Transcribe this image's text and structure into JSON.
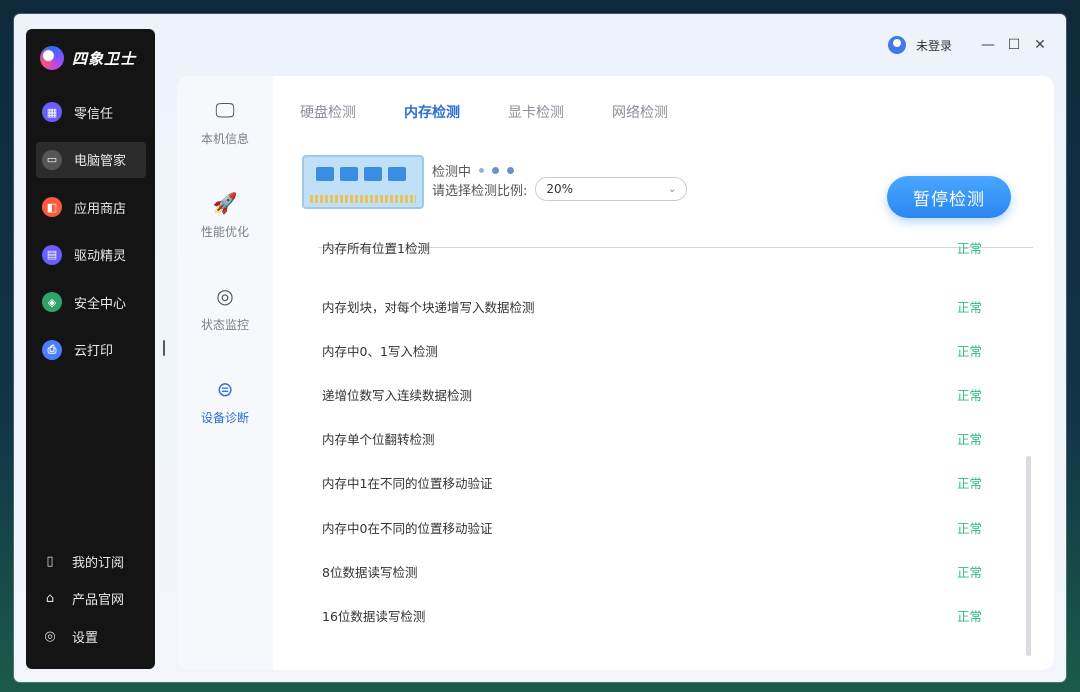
{
  "app": {
    "name": "四象卫士"
  },
  "sidebar": {
    "items": [
      {
        "label": "零信任",
        "icon": "grid-icon",
        "color": "#6b5cff"
      },
      {
        "label": "电脑管家",
        "icon": "monitor-icon",
        "color": "#3f3f3f"
      },
      {
        "label": "应用商店",
        "icon": "store-icon",
        "color": "#ff5a3c"
      },
      {
        "label": "驱动精灵",
        "icon": "driver-icon",
        "color": "#6b5cff"
      },
      {
        "label": "安全中心",
        "icon": "shield-icon",
        "color": "#2fa36b"
      },
      {
        "label": "云打印",
        "icon": "printer-icon",
        "color": "#4a7dff"
      }
    ],
    "bottom": [
      {
        "label": "我的订阅",
        "icon": "book-icon"
      },
      {
        "label": "产品官网",
        "icon": "home-icon"
      },
      {
        "label": "设置",
        "icon": "gear-icon"
      }
    ]
  },
  "topbar": {
    "login_label": "未登录"
  },
  "subnav": [
    {
      "label": "本机信息",
      "icon": "monitor-icon"
    },
    {
      "label": "性能优化",
      "icon": "rocket-icon"
    },
    {
      "label": "状态监控",
      "icon": "monitor-circle-icon"
    },
    {
      "label": "设备诊断",
      "icon": "diagnose-icon"
    }
  ],
  "tabs": [
    "硬盘检测",
    "内存检测",
    "显卡检测",
    "网络检测"
  ],
  "detect": {
    "status": "检测中",
    "ratio_label": "请选择检测比例:",
    "ratio_value": "20%",
    "pause_button": "暂停检测"
  },
  "results": [
    {
      "name": "内存所有位置1检测",
      "status": "正常"
    },
    {
      "name": "内存划块，对每个块递增写入数据检测",
      "status": "正常"
    },
    {
      "name": "内存中0、1写入检测",
      "status": "正常"
    },
    {
      "name": "递增位数写入连续数据检测",
      "status": "正常"
    },
    {
      "name": "内存单个位翻转检测",
      "status": "正常"
    },
    {
      "name": "内存中1在不同的位置移动验证",
      "status": "正常"
    },
    {
      "name": "内存中0在不同的位置移动验证",
      "status": "正常"
    },
    {
      "name": "8位数据读写检测",
      "status": "正常"
    },
    {
      "name": "16位数据读写检测",
      "status": "正常"
    }
  ]
}
